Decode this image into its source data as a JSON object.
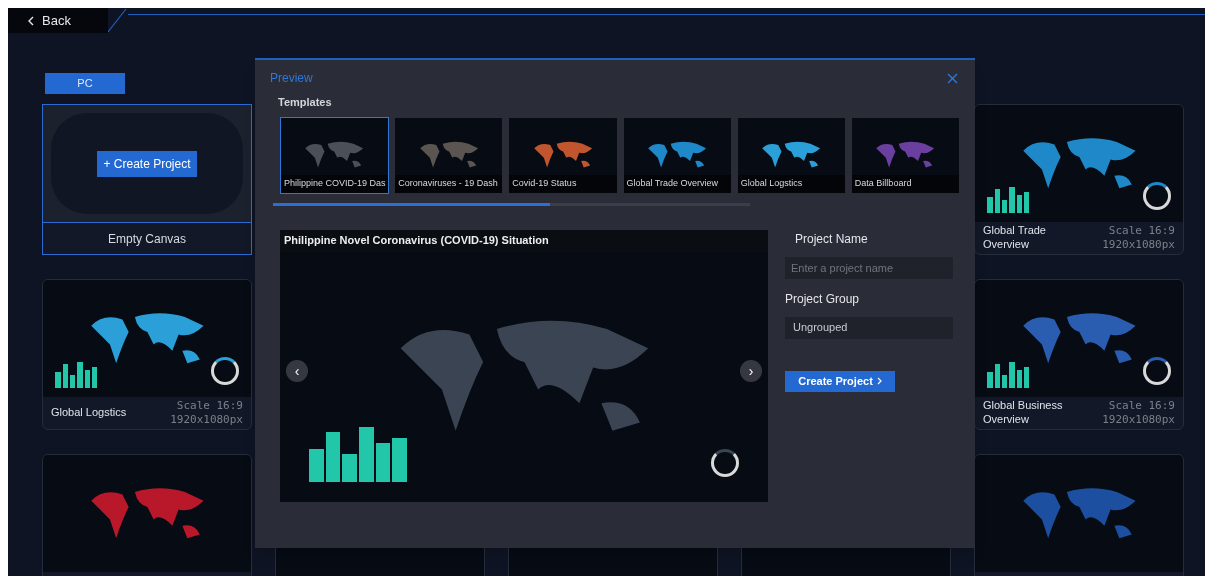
{
  "back": {
    "label": "Back"
  },
  "device_tab": {
    "label": "PC",
    "selected": true
  },
  "rows": [
    [
      {
        "kind": "empty",
        "button": "+ Create Project",
        "title": "Empty Canvas"
      },
      {
        "kind": "covered"
      },
      {
        "kind": "covered"
      },
      {
        "kind": "covered"
      },
      {
        "kind": "template",
        "title": "Global Trade Overview",
        "scale": "Scale 16:9",
        "size": "1920x1080px",
        "color": "#1e88c8"
      }
    ],
    [
      {
        "kind": "template",
        "title": "Global Logstics",
        "scale": "Scale 16:9",
        "size": "1920x1080px",
        "color": "#2a9fd8"
      },
      {
        "kind": "covered"
      },
      {
        "kind": "covered"
      },
      {
        "kind": "covered"
      },
      {
        "kind": "template",
        "title": "Global Business Overview",
        "scale": "Scale 16:9",
        "size": "1920x1080px",
        "color": "#2a5db0"
      }
    ],
    [
      {
        "kind": "preview",
        "color": "#b8182a"
      },
      {
        "kind": "frame"
      },
      {
        "kind": "frame"
      },
      {
        "kind": "frame"
      },
      {
        "kind": "preview",
        "color": "#1c4fa0"
      }
    ]
  ],
  "modal": {
    "title": "Preview",
    "section": "Templates",
    "templates": [
      {
        "label": "Philippine COVID-19 Das",
        "selected": true,
        "color": "#4a4f58"
      },
      {
        "label": "Coronaviruses - 19 Dash",
        "selected": false,
        "color": "#5a5550"
      },
      {
        "label": "Covid-19 Status",
        "selected": false,
        "color": "#c0552e"
      },
      {
        "label": "Global Trade Overview",
        "selected": false,
        "color": "#1e88c8"
      },
      {
        "label": "Global Logstics",
        "selected": false,
        "color": "#2a9fd8"
      },
      {
        "label": "Data Billboard",
        "selected": false,
        "color": "#6a3fa0"
      }
    ],
    "scroll": {
      "level": 0.58
    },
    "preview_title": "Philippine Novel Coronavirus (COVID-19) Situation",
    "name_label": "Project Name",
    "name_placeholder": "Enter a project name",
    "group_label": "Project Group",
    "group_value": "Ungrouped",
    "create": "Create Project",
    "prev": "‹",
    "next": "›"
  }
}
